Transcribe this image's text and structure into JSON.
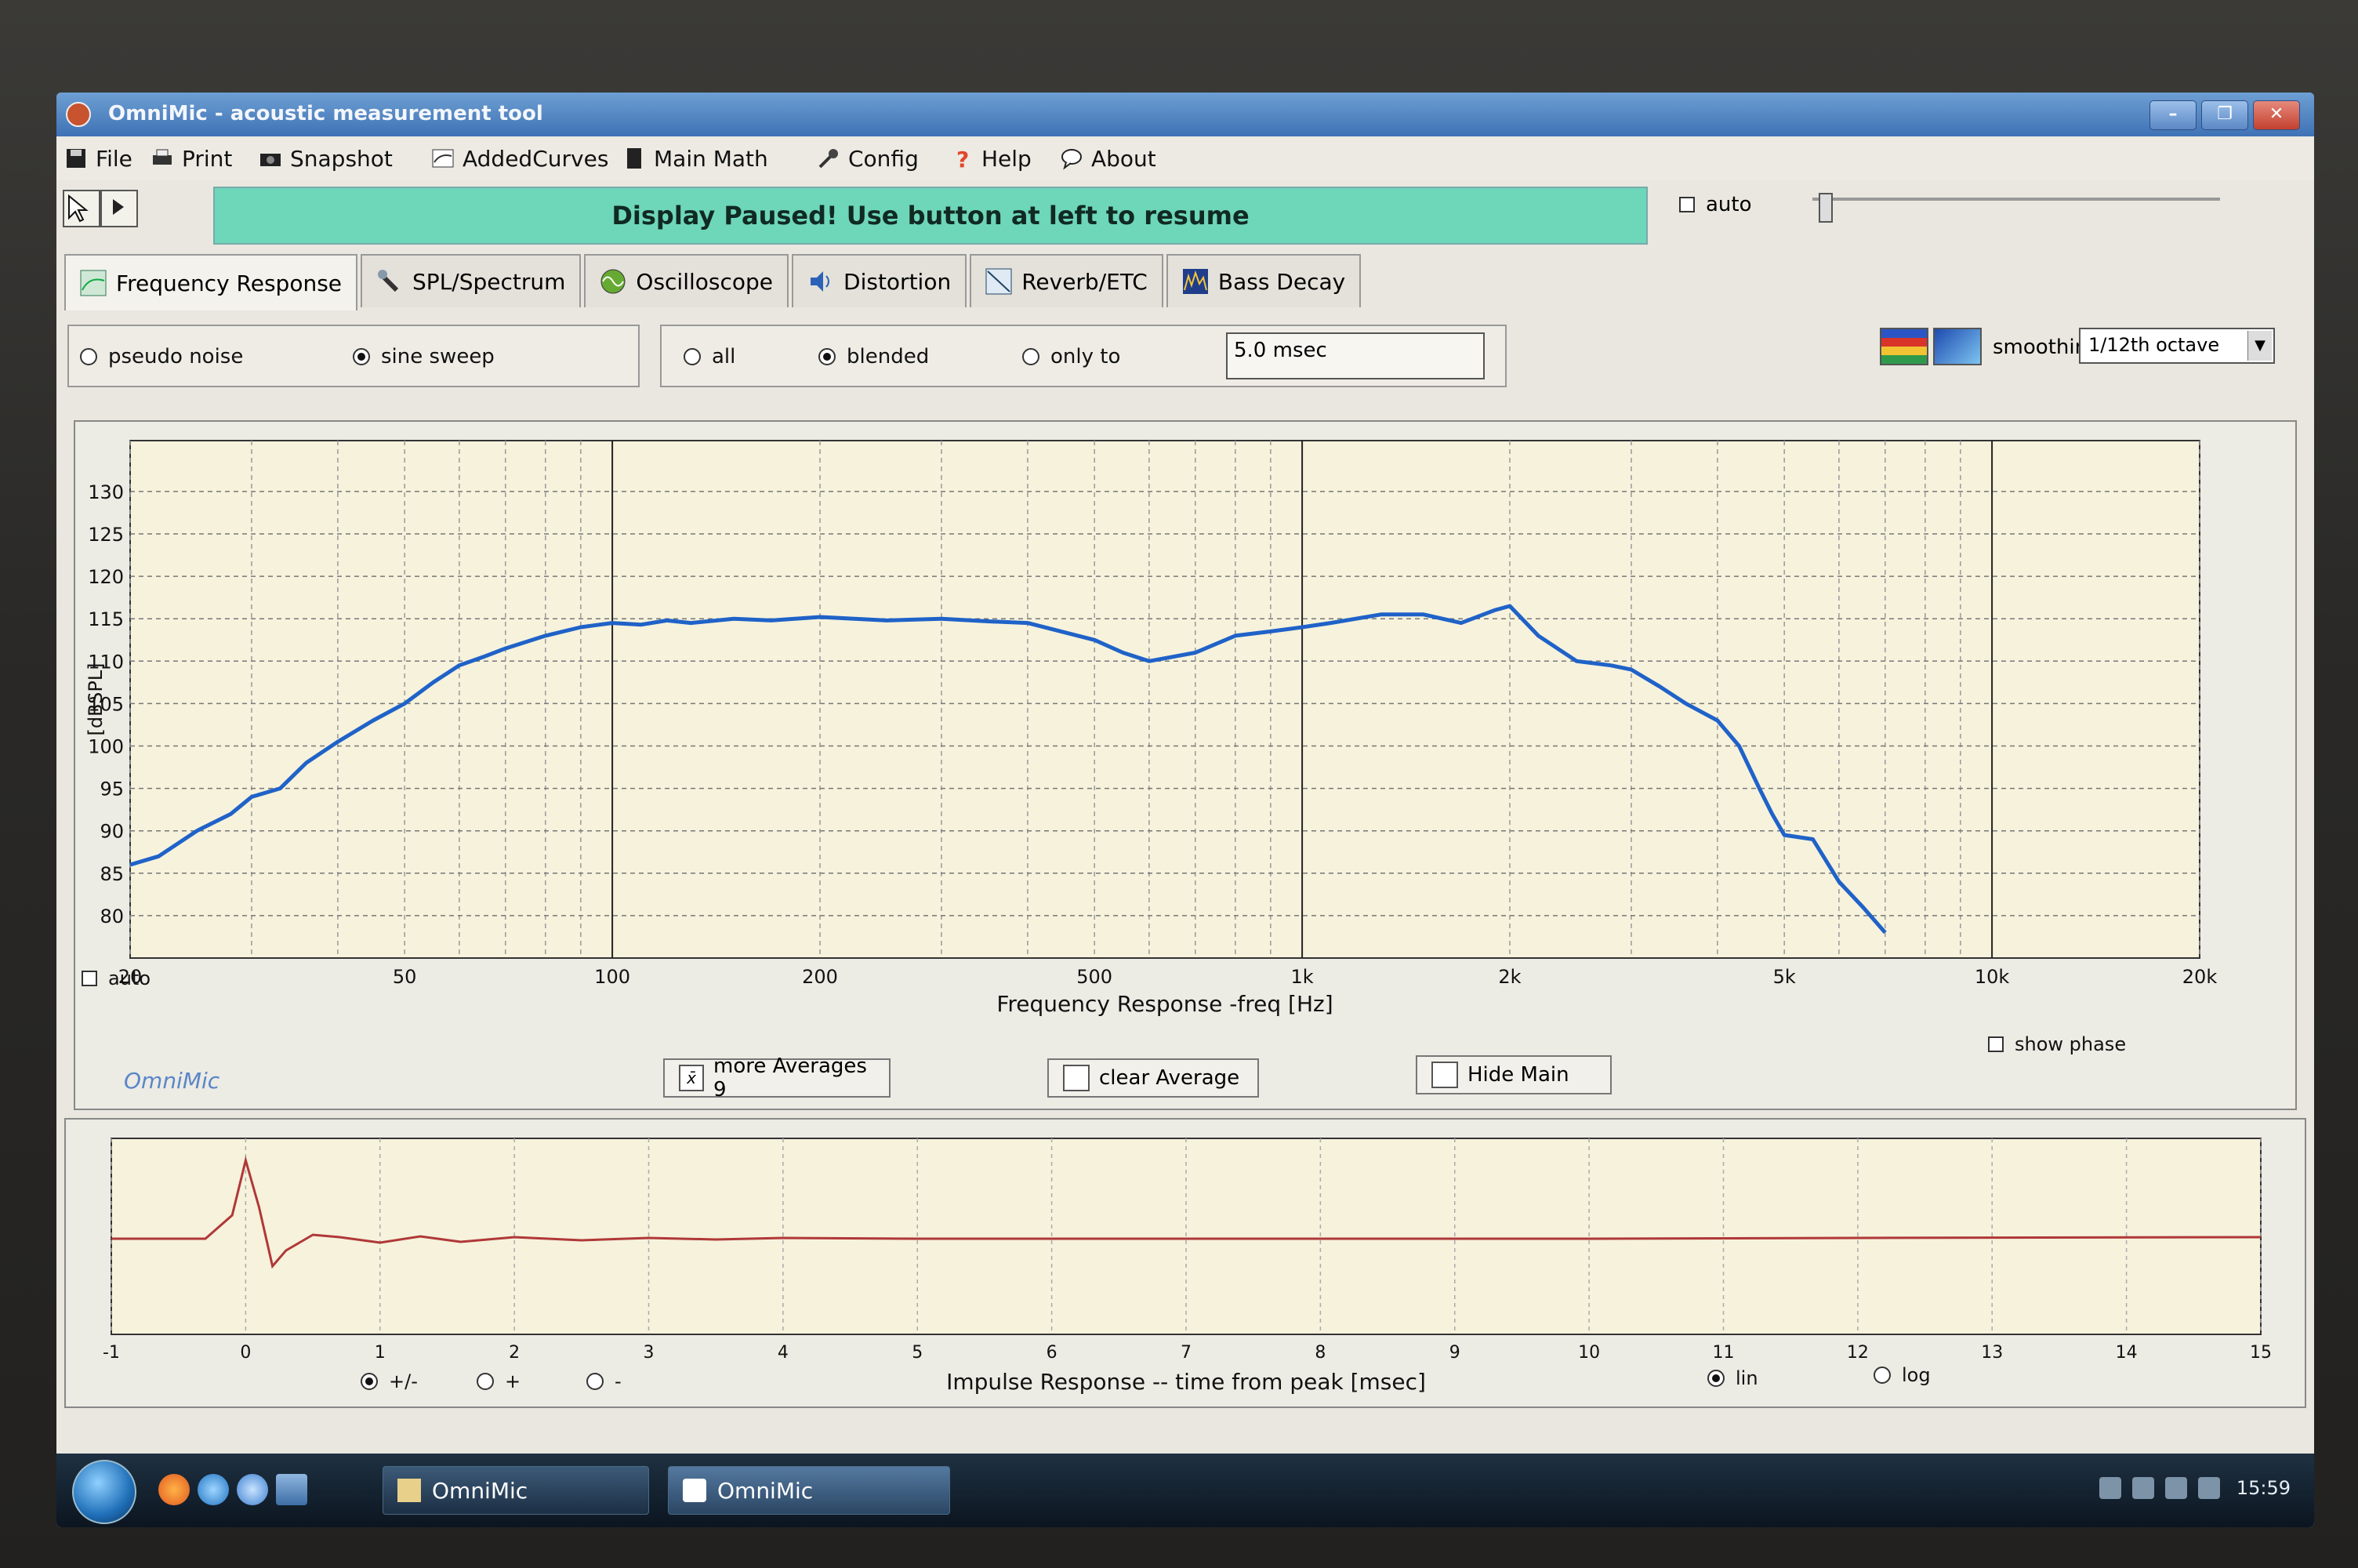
{
  "window": {
    "title": "OmniMic - acoustic measurement tool",
    "controls": [
      "–",
      "❐",
      "✕"
    ]
  },
  "menu": [
    {
      "label": "File",
      "icon": "floppy-icon"
    },
    {
      "label": "Print",
      "icon": "printer-icon"
    },
    {
      "label": "Snapshot",
      "icon": "camera-icon"
    },
    {
      "label": "AddedCurves",
      "icon": "curves-icon"
    },
    {
      "label": "Main Math",
      "icon": "calculator-icon"
    },
    {
      "label": "Config",
      "icon": "tools-icon"
    },
    {
      "label": "Help",
      "icon": "question-icon"
    },
    {
      "label": "About",
      "icon": "speech-bubble-icon"
    }
  ],
  "status": {
    "banner": "Display Paused! Use button at left to resume"
  },
  "top_controls": {
    "auto_label": "auto",
    "auto_checked": false
  },
  "tabs": [
    {
      "label": "Frequency Response",
      "active": true
    },
    {
      "label": "SPL/Spectrum",
      "active": false
    },
    {
      "label": "Oscilloscope",
      "active": false
    },
    {
      "label": "Distortion",
      "active": false
    },
    {
      "label": "Reverb/ETC",
      "active": false
    },
    {
      "label": "Bass Decay",
      "active": false
    }
  ],
  "signal": {
    "options": [
      "pseudo noise",
      "sine sweep"
    ],
    "selected": "sine sweep"
  },
  "gating": {
    "options": [
      "all",
      "blended",
      "only to"
    ],
    "selected": "blended",
    "value": "5.0 msec"
  },
  "smoothing": {
    "label": "smoothing",
    "value": "1/12th octave"
  },
  "fr_panel": {
    "auto_label": "auto",
    "brand": "OmniMic",
    "show_phase_label": "show phase",
    "buttons": {
      "more_averages": "more Averages 9",
      "clear_average": "clear Average",
      "hide_main": "Hide Main"
    }
  },
  "ir_panel": {
    "options": [
      "+/-",
      "+",
      "-"
    ],
    "selected": "+/-",
    "scale_options": [
      "lin",
      "log"
    ],
    "scale_selected": "lin"
  },
  "colors": {
    "plot_bg": "#f6f2dc",
    "fr_curve": "#1f62c8",
    "ir_curve": "#b03838",
    "banner": "#6ed6b9"
  },
  "chart_data": [
    {
      "type": "line",
      "title": "",
      "xlabel": "Frequency Response -freq [Hz]",
      "ylabel": "[dBSPL]",
      "xscale": "log",
      "xlim": [
        20,
        20000
      ],
      "ylim": [
        75,
        136
      ],
      "x_ticks": [
        20,
        50,
        100,
        200,
        500,
        1000,
        2000,
        5000,
        10000,
        20000
      ],
      "x_tick_labels": [
        "20",
        "50",
        "100",
        "200",
        "500",
        "1k",
        "2k",
        "5k",
        "10k",
        "20k"
      ],
      "y_ticks": [
        80,
        85,
        90,
        95,
        100,
        105,
        110,
        115,
        120,
        125,
        130
      ],
      "grid": true,
      "series": [
        {
          "x": [
            20,
            22,
            25,
            28,
            30,
            33,
            36,
            40,
            45,
            50,
            55,
            60,
            65,
            70,
            80,
            90,
            100,
            110,
            120,
            130,
            150,
            170,
            200,
            250,
            300,
            350,
            400,
            500,
            550,
            600,
            700,
            800,
            900,
            1000,
            1100,
            1300,
            1500,
            1700,
            1900,
            2000,
            2200,
            2500,
            2800,
            3000,
            3300,
            3600,
            4000,
            4300,
            4600,
            4800,
            5000,
            5500,
            6000,
            6500,
            7000
          ],
          "y": [
            86,
            87,
            90,
            92,
            94,
            95,
            98,
            100.5,
            103,
            105,
            107.5,
            109.5,
            110.5,
            111.5,
            113,
            114,
            114.5,
            114.3,
            114.8,
            114.5,
            115,
            114.8,
            115.2,
            114.8,
            115,
            114.7,
            114.5,
            112.5,
            111,
            110,
            111,
            113,
            113.5,
            114,
            114.5,
            115.5,
            115.5,
            114.5,
            116,
            116.5,
            113,
            110,
            109.5,
            109,
            107,
            105,
            103,
            100,
            95,
            92,
            89.5,
            89,
            84,
            81,
            78
          ]
        }
      ]
    },
    {
      "type": "line",
      "title": "",
      "xlabel": "Impulse Response  -- time from peak [msec]",
      "ylabel": "",
      "xlim": [
        -1,
        15
      ],
      "x_ticks": [
        -1,
        0,
        1,
        2,
        3,
        4,
        5,
        6,
        7,
        8,
        9,
        10,
        11,
        12,
        13,
        14,
        15
      ],
      "grid": true,
      "series": [
        {
          "x": [
            -1,
            -0.3,
            -0.1,
            0,
            0.1,
            0.2,
            0.3,
            0.5,
            0.7,
            1,
            1.3,
            1.6,
            2,
            2.5,
            3,
            3.5,
            4,
            5,
            6,
            8,
            10,
            12,
            15
          ],
          "y": [
            0,
            0,
            0.3,
            1.0,
            0.4,
            -0.35,
            -0.15,
            0.05,
            0.02,
            -0.05,
            0.03,
            -0.04,
            0.02,
            -0.02,
            0.01,
            -0.01,
            0.01,
            0,
            0,
            0,
            0,
            0.01,
            0.02
          ]
        }
      ]
    }
  ],
  "taskbar": {
    "tasks": [
      "OmniMic",
      "OmniMic"
    ],
    "clock": "15:59"
  }
}
